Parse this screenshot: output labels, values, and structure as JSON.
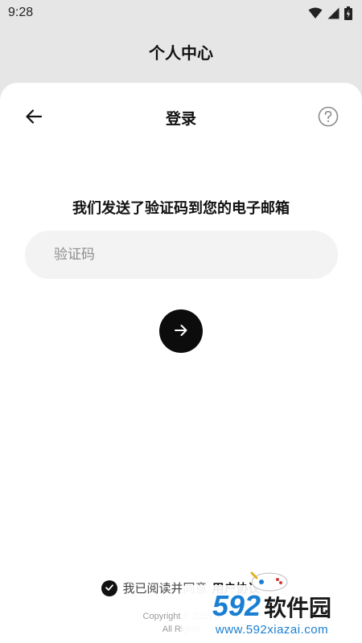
{
  "status_bar": {
    "time": "9:28"
  },
  "header": {
    "title": "个人中心"
  },
  "login_sheet": {
    "title": "登录",
    "instruction": "我们发送了验证码到您的电子邮箱",
    "code_input": {
      "placeholder": "验证码",
      "value": ""
    },
    "agreement": {
      "checked": true,
      "prefix": "我已阅读并同意",
      "link_text": "用户协议"
    },
    "copyright": {
      "line1": "Copyright © 2025 a",
      "line2": "All Rights"
    }
  },
  "watermark": {
    "brand_number": "592",
    "brand_name": "软件园",
    "url": "www.592xiazai.com"
  },
  "colors": {
    "page_background": "#e6e6e6",
    "sheet_background": "#ffffff",
    "primary": "#0c0c0c",
    "input_background": "#f3f3f3",
    "watermark_blue": "#1a7fd3"
  },
  "icons": {
    "back": "arrow-left-icon",
    "help": "question-circle-icon",
    "submit": "arrow-right-icon",
    "check": "check-icon",
    "wifi": "wifi-icon",
    "signal": "signal-icon",
    "battery": "battery-charging-icon"
  }
}
